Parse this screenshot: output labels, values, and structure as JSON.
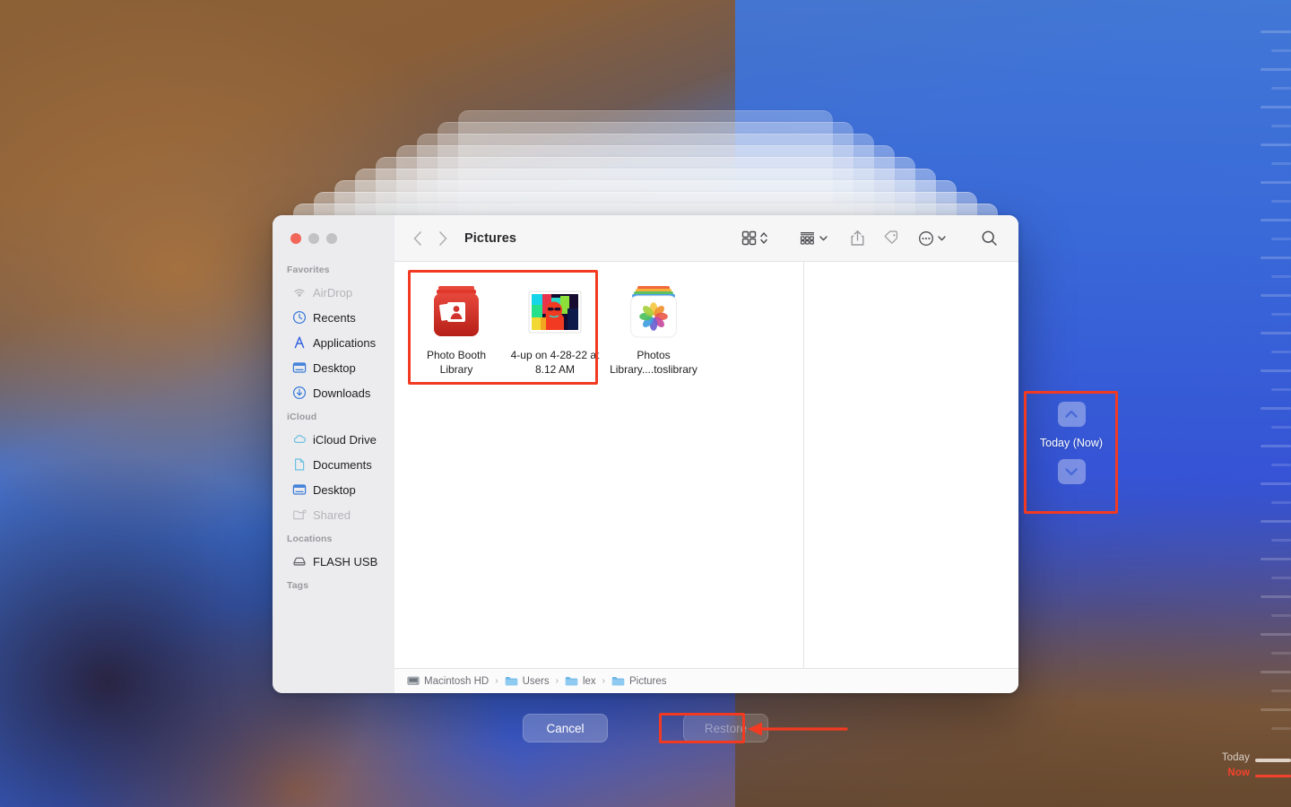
{
  "window": {
    "title": "Pictures",
    "traffic_lights": [
      "close",
      "minimize",
      "maximize"
    ],
    "nav_back": "back",
    "nav_forward": "forward"
  },
  "sidebar": {
    "sections": [
      {
        "title": "Favorites",
        "items": [
          {
            "label": "AirDrop",
            "icon": "airdrop-icon",
            "dim": true
          },
          {
            "label": "Recents",
            "icon": "clock-icon",
            "dim": false
          },
          {
            "label": "Applications",
            "icon": "applications-icon",
            "dim": false
          },
          {
            "label": "Desktop",
            "icon": "desktop-icon",
            "dim": false
          },
          {
            "label": "Downloads",
            "icon": "downloads-icon",
            "dim": false
          }
        ]
      },
      {
        "title": "iCloud",
        "items": [
          {
            "label": "iCloud Drive",
            "icon": "cloud-icon",
            "dim": false
          },
          {
            "label": "Documents",
            "icon": "document-icon",
            "dim": false
          },
          {
            "label": "Desktop",
            "icon": "desktop-icon",
            "dim": false
          },
          {
            "label": "Shared",
            "icon": "shared-icon",
            "dim": true
          }
        ]
      },
      {
        "title": "Locations",
        "items": [
          {
            "label": "FLASH USB",
            "icon": "drive-icon",
            "dim": false
          }
        ]
      },
      {
        "title": "Tags",
        "items": []
      }
    ]
  },
  "toolbar": {
    "buttons": [
      {
        "name": "view-grid-button",
        "icon": "grid-view-icon",
        "chevron": "updown"
      },
      {
        "name": "group-by-button",
        "icon": "list-group-icon",
        "chevron": "down"
      },
      {
        "name": "share-button",
        "icon": "share-icon",
        "chevron": "none"
      },
      {
        "name": "tag-button",
        "icon": "tag-icon",
        "chevron": "none"
      },
      {
        "name": "more-actions-button",
        "icon": "ellipsis-circle-icon",
        "chevron": "down"
      },
      {
        "name": "search-button",
        "icon": "search-icon",
        "chevron": "none"
      }
    ]
  },
  "files": [
    {
      "name": "Photo Booth Library",
      "icon": "photo-booth-library-icon",
      "selected": true
    },
    {
      "name": "4-up on 4-28-22 at 8.12 AM",
      "icon": "photo-thumbnail-icon",
      "selected": true
    },
    {
      "name": "Photos Library....toslibrary",
      "icon": "photos-library-icon",
      "selected": false
    }
  ],
  "path_bar": {
    "segments": [
      {
        "label": "Macintosh HD",
        "icon": "hard-drive-icon"
      },
      {
        "label": "Users",
        "icon": "folder-icon"
      },
      {
        "label": "lex",
        "icon": "folder-icon"
      },
      {
        "label": "Pictures",
        "icon": "folder-icon"
      }
    ],
    "separator": "›"
  },
  "actions": {
    "cancel_label": "Cancel",
    "restore_label": "Restore",
    "restore_disabled": true
  },
  "time_machine": {
    "nav_label": "Today (Now)",
    "up_icon": "chevron-up-icon",
    "down_icon": "chevron-down-icon",
    "timeline": {
      "today_label": "Today",
      "now_label": "Now"
    }
  },
  "colors": {
    "annotation_red": "#f23a22",
    "accent_blue": "#3a6fd8",
    "now_red": "#f4422d",
    "sidebar_bg": "#ececee",
    "toolbar_bg": "#f6f6f7"
  }
}
